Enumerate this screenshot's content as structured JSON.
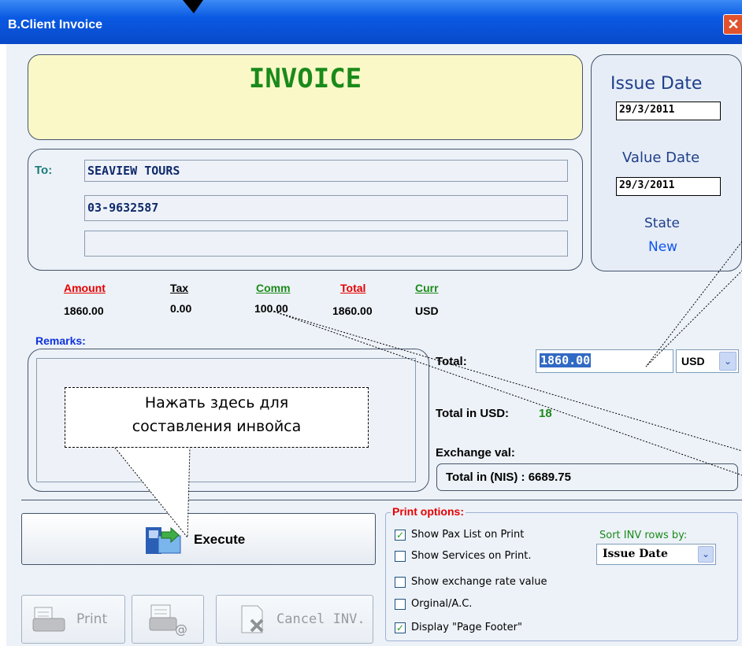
{
  "window": {
    "title": "B.Client Invoice",
    "close_glyph": "✕"
  },
  "invoice_banner": {
    "title": "INVOICE"
  },
  "dates": {
    "issue_label": "Issue Date",
    "issue_value": "29/3/2011",
    "value_label": "Value Date",
    "value_value": "29/3/2011",
    "state_label": "State",
    "state_value": "New"
  },
  "recipient": {
    "to_label": "To:",
    "name": "SEAVIEW TOURS",
    "phone": "03-9632587",
    "extra": ""
  },
  "summary": {
    "headers": [
      {
        "label": "Amount",
        "color": "#e60000"
      },
      {
        "label": "Tax",
        "color": "#000000"
      },
      {
        "label": "Comm",
        "color": "#1a8a1a"
      },
      {
        "label": "Total",
        "color": "#e60000"
      },
      {
        "label": "Curr",
        "color": "#1a8a1a"
      }
    ],
    "values": [
      "1860.00",
      "0.00",
      "100.00",
      "1860.00",
      "USD"
    ]
  },
  "remarks": {
    "label": "Remarks:"
  },
  "totals": {
    "total_label": "Total:",
    "total_value": "1860.00",
    "currency": "USD",
    "total_in_usd_label": "Total in USD:",
    "total_in_usd_value": "18",
    "exchange_label": "Exchange val:",
    "total_in_nis": "Total in (NIS) : 6689.75"
  },
  "callout": {
    "line1": "Нажать здесь для",
    "line2": "составления инвойса"
  },
  "actions": {
    "execute": "Execute",
    "print": "Print",
    "cancel": "Cancel INV."
  },
  "print_options": {
    "title": "Print options:",
    "items": [
      {
        "label": "Show Pax List  on Print",
        "checked": true,
        "mark": "✓"
      },
      {
        "label": "Show Services on Print.",
        "checked": false,
        "mark": ""
      },
      {
        "label": "Show exchange rate value",
        "checked": false,
        "mark": ""
      },
      {
        "label": "Orginal/A.C.",
        "checked": false,
        "mark": ""
      },
      {
        "label": "Display \"Page Footer\"",
        "checked": true,
        "mark": "✓"
      }
    ],
    "sort_label": "Sort INV rows by:",
    "sort_value": "Issue Date"
  },
  "colors": {
    "titlebar": "#0a5ae3",
    "banner_bg": "#fbf8c8",
    "invoice_green": "#1a8a1a",
    "date_blue": "#1f3f8a",
    "link_blue": "#1155ee",
    "print_red": "#e60000"
  }
}
